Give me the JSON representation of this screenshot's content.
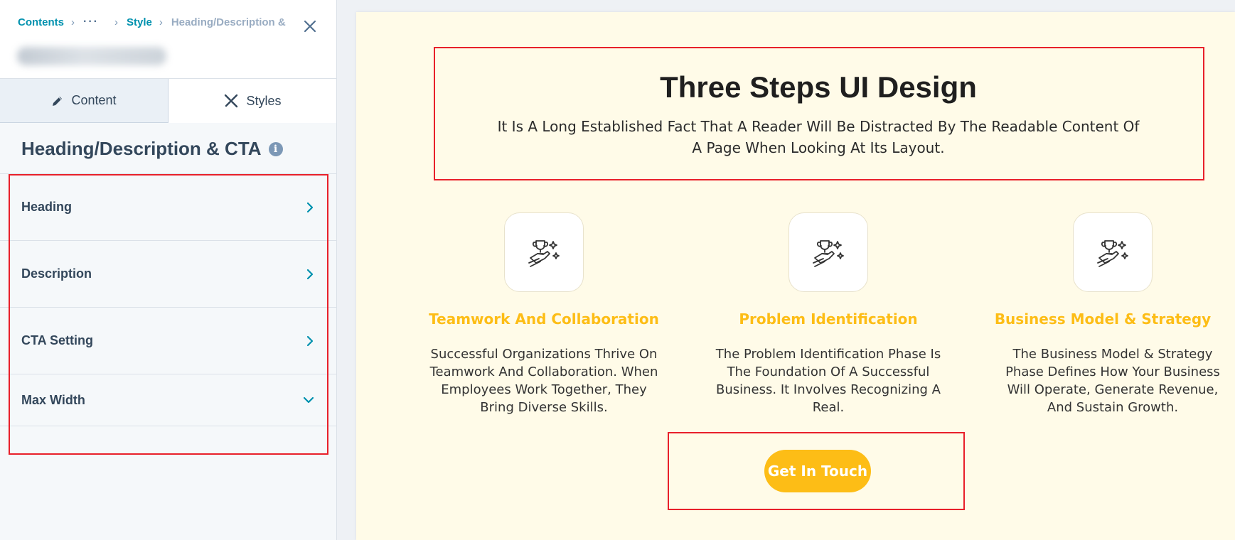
{
  "breadcrumb": {
    "contents": "Contents",
    "separator": "›",
    "ellipsis": "···",
    "style": "Style",
    "current": "Heading/Description &"
  },
  "tabs": [
    {
      "label": "Content",
      "icon": "pencil-icon"
    },
    {
      "label": "Styles",
      "icon": "styles-brush-icon"
    }
  ],
  "panel": {
    "title": "Heading/Description & CTA",
    "info_glyph": "i",
    "sections": [
      {
        "label": "Heading",
        "icon": "chevron-right-icon"
      },
      {
        "label": "Description",
        "icon": "chevron-right-icon"
      },
      {
        "label": "CTA Setting",
        "icon": "chevron-right-icon"
      },
      {
        "label": "Max Width",
        "icon": "chevron-down-icon"
      }
    ]
  },
  "preview": {
    "heading": "Three Steps UI Design",
    "description": "It Is A Long Established Fact That A Reader Will Be Distracted By The Readable Content Of A Page When Looking At Its Layout.",
    "steps": [
      {
        "title": "Teamwork And Collaboration",
        "text": "Successful Organizations Thrive On Teamwork And Collaboration. When Employees Work Together, They Bring Diverse Skills.",
        "icon": "trophy-hand-icon"
      },
      {
        "title": "Problem Identification",
        "text": "The Problem Identification Phase Is The Foundation Of A Successful Business. It Involves Recognizing A Real.",
        "icon": "trophy-hand-icon"
      },
      {
        "title": "Business Model & Strategy",
        "text": "The Business Model & Strategy Phase Defines How Your Business Will Operate, Generate Revenue, And Sustain Growth.",
        "icon": "trophy-hand-icon"
      }
    ],
    "cta_label": "Get In Touch"
  },
  "colors": {
    "accent_link": "#0091ae",
    "step_title": "#fdbd16",
    "button_bg": "#fdbd16",
    "preview_bg": "#fffbe8",
    "annotation_red": "#e8202a"
  }
}
